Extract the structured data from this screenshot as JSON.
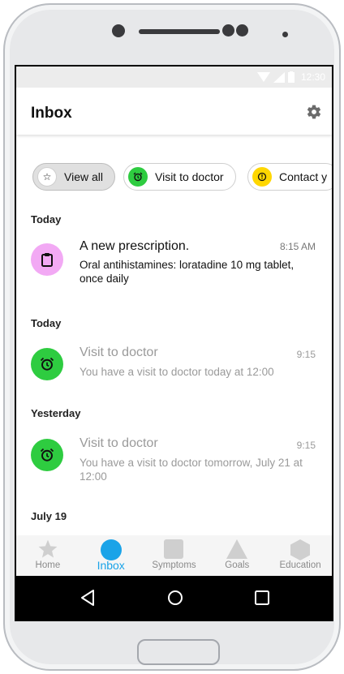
{
  "status_bar": {
    "time": "12:30"
  },
  "header": {
    "title": "Inbox"
  },
  "filters": [
    {
      "label": "View all",
      "icon": "star-icon",
      "color": "#e0e0e0",
      "selected": true
    },
    {
      "label": "Visit to doctor",
      "icon": "alarm-clock-icon",
      "color": "#2ecc40",
      "selected": false
    },
    {
      "label": "Contact y",
      "icon": "info-icon",
      "color": "#ffd700",
      "selected": false
    }
  ],
  "sections": [
    {
      "label": "Today"
    },
    {
      "label": "Today"
    },
    {
      "label": "Yesterday"
    },
    {
      "label": "July 19"
    }
  ],
  "messages": [
    {
      "title": "A new prescription.",
      "time": "8:15 AM",
      "body": "Oral antihistamines: loratadine 10 mg tablet, once daily",
      "icon": "clipboard-icon",
      "color": "#f2a9f4",
      "read": false
    },
    {
      "title": "Visit to doctor",
      "time": "9:15",
      "body": "You have a visit to doctor today at 12:00",
      "icon": "alarm-clock-icon",
      "color": "#2ecc40",
      "read": true
    },
    {
      "title": "Visit to doctor",
      "time": "9:15",
      "body": "You have a visit to doctor tomorrow, July 21 at 12:00",
      "icon": "alarm-clock-icon",
      "color": "#2ecc40",
      "read": true
    }
  ],
  "bottom_nav": [
    {
      "label": "Home",
      "icon": "star-icon"
    },
    {
      "label": "Inbox",
      "icon": "circle-icon",
      "active": true
    },
    {
      "label": "Symptoms",
      "icon": "square-icon"
    },
    {
      "label": "Goals",
      "icon": "triangle-icon"
    },
    {
      "label": "Education",
      "icon": "hexagon-icon"
    }
  ],
  "colors": {
    "accent": "#1aa3e8",
    "green": "#2ecc40",
    "yellow": "#ffd700",
    "pink": "#f2a9f4"
  }
}
